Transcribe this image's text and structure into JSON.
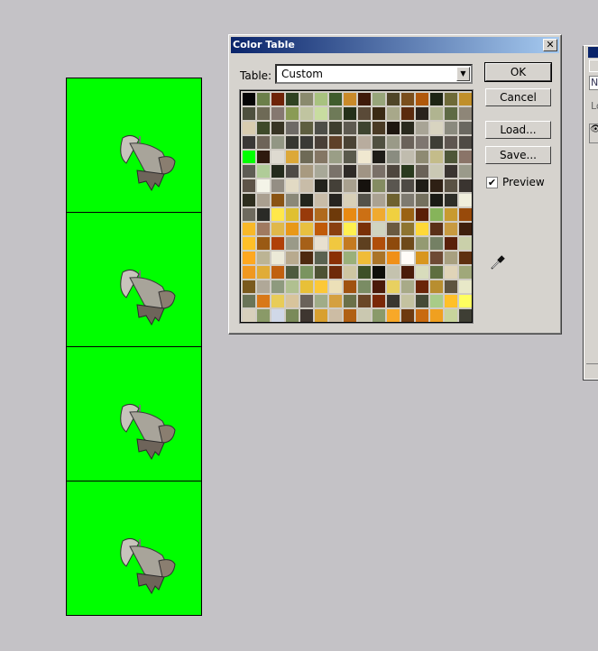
{
  "dialog": {
    "title": "Color Table",
    "table_label": "Table:",
    "table_value": "Custom",
    "ok": "OK",
    "cancel": "Cancel",
    "load": "Load...",
    "save": "Save...",
    "preview_label": "Preview",
    "preview_checked": true
  },
  "canvas": {
    "background": "#00ff00",
    "frames": 4
  },
  "panel": {
    "field_text": "N",
    "label_text": "Lo"
  },
  "colors": [
    [
      "#050505",
      "#6b7f4a",
      "#6e2308",
      "#2f4222",
      "#8a8a6e",
      "#a8c27f",
      "#3f5c2c",
      "#c98a2a",
      "#3f1a0a",
      "#97a57a",
      "#4f4528",
      "#7a4e1c",
      "#b0580c",
      "#1e2414",
      "#6e6a38",
      "#c08f2a"
    ],
    [
      "#4e503e",
      "#6e6a56",
      "#857870",
      "#8a9b55",
      "#c0c4a0",
      "#c8dca0",
      "#6e7a58",
      "#24301a",
      "#5a4a38",
      "#3a2a14",
      "#a8a88a",
      "#5a2a0e",
      "#2a221c",
      "#b0b490",
      "#5e6a44",
      "#8e8678"
    ],
    [
      "#d8ccb0",
      "#3e4a2a",
      "#383424",
      "#6e6a66",
      "#5e5e40",
      "#4e4e48",
      "#3e3e2e",
      "#5e5a50",
      "#3e4430",
      "#4a3a24",
      "#1e1610",
      "#2a2a1e",
      "#a8a496",
      "#d8d4c0",
      "#8a8a7e",
      "#6a6860"
    ],
    [
      "#3a3836",
      "#6e6458",
      "#929684",
      "#363630",
      "#3a3a36",
      "#4a4038",
      "#5e4028",
      "#4a4234",
      "#b8ac9e",
      "#505040",
      "#9a9a88",
      "#6a625a",
      "#7e7670",
      "#3e3e36",
      "#5e5650",
      "#4e4a44"
    ],
    [
      "#00ff00",
      "#2e1a0e",
      "#dedad0",
      "#dca838",
      "#6e6a56",
      "#847664",
      "#9a9e86",
      "#5a5a4c",
      "#f0e8d0",
      "#1e1c18",
      "#8a8c80",
      "#c0bcae",
      "#8e8a72",
      "#c4bc8a",
      "#4e5638",
      "#8a7468"
    ],
    [
      "#5e5c54",
      "#b0cc98",
      "#242a1c",
      "#4e4a46",
      "#a89a80",
      "#a8a898",
      "#7a726a",
      "#2e2a26",
      "#a09484",
      "#7a7068",
      "#4e463e",
      "#2a3a1e",
      "#6a6258",
      "#cac8b4",
      "#3a3430",
      "#9a9a8a"
    ],
    [
      "#5e5448",
      "#f4f4e8",
      "#948e84",
      "#e2dac4",
      "#c8bca8",
      "#22221c",
      "#444038",
      "#a8a08e",
      "#16120e",
      "#848c62",
      "#5a5650",
      "#4e4a44",
      "#1e1c16",
      "#2e2014",
      "#5a5244",
      "#3a3430"
    ],
    [
      "#2e2e1e",
      "#aaa090",
      "#8a5414",
      "#8a8878",
      "#22241c",
      "#c8bca8",
      "#262420",
      "#d8d0b8",
      "#54524a",
      "#aaa292",
      "#6e6230",
      "#7e7a70",
      "#74705e",
      "#1a1a14",
      "#2e2e28",
      "#f0eedc"
    ],
    [
      "#6e6a5e",
      "#2a2a26",
      "#ffe84a",
      "#e0c030",
      "#983a0a",
      "#b06a1e",
      "#6e3a0a",
      "#e88a12",
      "#cc7014",
      "#f0aa30",
      "#f0d040",
      "#9a6214",
      "#5a1e06",
      "#86b45a",
      "#c89a30",
      "#984a0a"
    ],
    [
      "#f8b828",
      "#a07a60",
      "#e0b84a",
      "#e89818",
      "#e8c040",
      "#c05a08",
      "#8a4010",
      "#fff050",
      "#7a3008",
      "#d0d4c0",
      "#6a5a40",
      "#8e7430",
      "#ffd838",
      "#5a3018",
      "#c89a40",
      "#3e200e"
    ],
    [
      "#ffc028",
      "#9a5a14",
      "#b04008",
      "#9a9a88",
      "#a66018",
      "#e8e0d0",
      "#f0c840",
      "#c47a20",
      "#5e4020",
      "#b04e0a",
      "#8e4a0c",
      "#6e4a1a",
      "#949a72",
      "#748064",
      "#5a200a",
      "#cad0aa"
    ],
    [
      "#ffa820",
      "#bcb494",
      "#ecead8",
      "#b8aa8e",
      "#4e2a10",
      "#5a6250",
      "#8a3006",
      "#9ab07a",
      "#f0bc38",
      "#aa7428",
      "#f09018",
      "#fffcf8",
      "#d8961e",
      "#6e4a34",
      "#a8a080",
      "#5e3010"
    ],
    [
      "#f09820",
      "#e0ac38",
      "#c06010",
      "#4e5a3e",
      "#7a9460",
      "#4e5234",
      "#6e2a0a",
      "#cec6a2",
      "#3e5028",
      "#0e0e0a",
      "#c4c2ae",
      "#4a1c0a",
      "#d8dcbc",
      "#5e6e40",
      "#e0d4b8",
      "#a0a87a"
    ],
    [
      "#7a5a1e",
      "#b0a898",
      "#8e9a7e",
      "#b0c090",
      "#e8c038",
      "#fcc838",
      "#ece0b8",
      "#a05210",
      "#7a8c64",
      "#4a1a0a",
      "#e8d060",
      "#a8aa88",
      "#6a2408",
      "#b88e30",
      "#5e5440",
      "#e8e8c8"
    ],
    [
      "#6a7458",
      "#d87818",
      "#e8cc58",
      "#d8c49c",
      "#6a625a",
      "#a0ac88",
      "#d4a040",
      "#6a7048",
      "#6a4628",
      "#7a2808",
      "#3a3630",
      "#c4c2a0",
      "#464a36",
      "#a8cc88",
      "#ffc028",
      "#ffff60"
    ],
    [
      "#d8d0bc",
      "#8a9a68",
      "#d0d8e8",
      "#7a8a5a",
      "#3e3630",
      "#d8a030",
      "#ccbca4",
      "#b06014",
      "#cac8b0",
      "#8a9a6a",
      "#f8a828",
      "#6e3a10",
      "#c86a10",
      "#f0a020",
      "#c8d49c",
      "#3e3e34"
    ]
  ]
}
